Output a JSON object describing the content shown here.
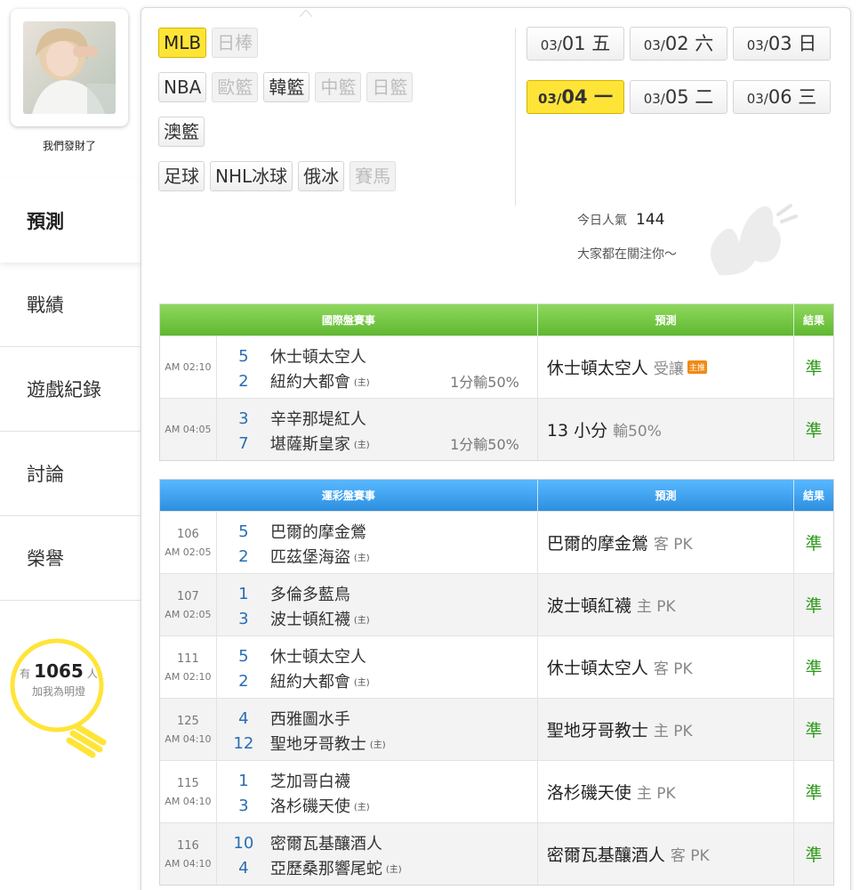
{
  "profile": {
    "username": "我們發財了"
  },
  "nav": {
    "items": [
      {
        "label": "預測"
      },
      {
        "label": "戰績"
      },
      {
        "label": "遊戲紀錄"
      },
      {
        "label": "討論"
      },
      {
        "label": "榮譽"
      }
    ]
  },
  "fans": {
    "prefix": "有",
    "count": "1065",
    "suffix": "人",
    "caption": "加我為明燈"
  },
  "sports": {
    "row1": [
      {
        "label": "MLB"
      },
      {
        "label": "日棒"
      }
    ],
    "row2": [
      {
        "label": "NBA"
      },
      {
        "label": "歐籃"
      },
      {
        "label": "韓籃"
      },
      {
        "label": "中籃"
      },
      {
        "label": "日籃"
      }
    ],
    "row3": [
      {
        "label": "澳籃"
      }
    ],
    "row4": [
      {
        "label": "足球"
      },
      {
        "label": "NHL冰球"
      },
      {
        "label": "俄冰"
      },
      {
        "label": "賽馬"
      }
    ]
  },
  "dates": [
    {
      "md": "03/",
      "dd": "01 五"
    },
    {
      "md": "03/",
      "dd": "02 六"
    },
    {
      "md": "03/",
      "dd": "03 日"
    },
    {
      "md": "03/",
      "dd": "04 一"
    },
    {
      "md": "03/",
      "dd": "05 二"
    },
    {
      "md": "03/",
      "dd": "06 三"
    }
  ],
  "popularity": {
    "label": "今日人氣",
    "value": "144",
    "tagline": "大家都在關注你～"
  },
  "intl": {
    "headers": {
      "game": "國際盤賽事",
      "pred": "預測",
      "result": "結果"
    },
    "rows": [
      {
        "time": "AM 02:10",
        "s1": "5",
        "t1": "休士頓太空人",
        "s2": "2",
        "t2": "紐約大都會",
        "home": "(主)",
        "odds": "1分輸50%",
        "pred": "休士頓太空人",
        "predSub": "受讓",
        "badge": "主推",
        "result": "準"
      },
      {
        "time": "AM 04:05",
        "s1": "3",
        "t1": "辛辛那堤紅人",
        "s2": "7",
        "t2": "堪薩斯皇家",
        "home": "(主)",
        "odds": "1分輸50%",
        "pred": "13 小分",
        "predSub": "輸50%",
        "result": "準"
      }
    ]
  },
  "lottery": {
    "headers": {
      "game": "運彩盤賽事",
      "pred": "預測",
      "result": "結果"
    },
    "rows": [
      {
        "num": "106",
        "time": "AM 02:05",
        "s1": "5",
        "t1": "巴爾的摩金鶯",
        "s2": "2",
        "t2": "匹茲堡海盜",
        "home": "(主)",
        "pred": "巴爾的摩金鶯",
        "predSub": "客 PK",
        "result": "準"
      },
      {
        "num": "107",
        "time": "AM 02:05",
        "s1": "1",
        "t1": "多倫多藍鳥",
        "s2": "3",
        "t2": "波士頓紅襪",
        "home": "(主)",
        "pred": "波士頓紅襪",
        "predSub": "主 PK",
        "result": "準"
      },
      {
        "num": "111",
        "time": "AM 02:10",
        "s1": "5",
        "t1": "休士頓太空人",
        "s2": "2",
        "t2": "紐約大都會",
        "home": "(主)",
        "pred": "休士頓太空人",
        "predSub": "客 PK",
        "result": "準"
      },
      {
        "num": "125",
        "time": "AM 04:10",
        "s1": "4",
        "t1": "西雅圖水手",
        "s2": "12",
        "t2": "聖地牙哥教士",
        "home": "(主)",
        "pred": "聖地牙哥教士",
        "predSub": "主 PK",
        "result": "準"
      },
      {
        "num": "115",
        "time": "AM 04:10",
        "s1": "1",
        "t1": "芝加哥白襪",
        "s2": "3",
        "t2": "洛杉磯天使",
        "home": "(主)",
        "pred": "洛杉磯天使",
        "predSub": "主 PK",
        "result": "準"
      },
      {
        "num": "116",
        "time": "AM 04:10",
        "s1": "10",
        "t1": "密爾瓦基釀酒人",
        "s2": "4",
        "t2": "亞歷桑那響尾蛇",
        "home": "(主)",
        "pred": "密爾瓦基釀酒人",
        "predSub": "客 PK",
        "result": "準"
      }
    ]
  },
  "colors": {
    "accent": "#ffe438",
    "intlHeader": "#6cc43c",
    "lotteryHeader": "#3ca0ef",
    "result": "#2e9a1b",
    "score": "#2a6db5"
  }
}
